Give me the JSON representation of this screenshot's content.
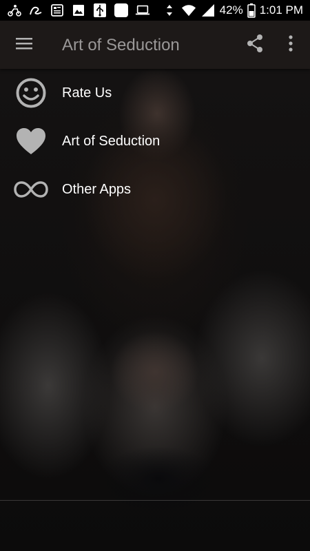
{
  "status_bar": {
    "battery": "42%",
    "time": "1:01 PM",
    "icons": [
      "scooter-icon",
      "app-logo-icon",
      "news-icon",
      "image-icon",
      "usb-icon",
      "blank-app-icon",
      "laptop-icon",
      "data-arrows-icon",
      "wifi-icon",
      "signal-icon",
      "battery-icon"
    ]
  },
  "app_bar": {
    "title": "Art of Seduction",
    "icons": [
      "hamburger-menu-icon",
      "share-icon",
      "more-vert-icon"
    ]
  },
  "menu": {
    "items": [
      {
        "label": "Rate Us",
        "icon": "smiley-face-icon"
      },
      {
        "label": "Art of Seduction",
        "icon": "heart-icon"
      },
      {
        "label": "Other Apps",
        "icon": "infinity-icon"
      }
    ]
  },
  "colors": {
    "status_bar_bg": "#000000",
    "app_bar_bg": "#1d1918",
    "title_text": "#9a9898",
    "icon_gray": "#b3b3b3",
    "label_text": "#ffffff"
  }
}
